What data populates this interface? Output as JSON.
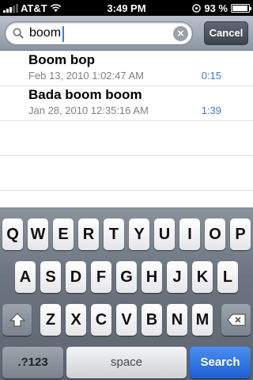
{
  "status_bar": {
    "carrier": "AT&T",
    "time": "3:49 PM",
    "battery_percent": "93 %",
    "battery_level": 0.93,
    "signal_bars_on": 3
  },
  "search": {
    "query": "boom",
    "cancel_label": "Cancel"
  },
  "results": [
    {
      "title": "Boom bop",
      "date": "Feb 13, 2010 1:02:47 AM",
      "duration": "0:15"
    },
    {
      "title": "Bada boom boom",
      "date": "Jan 28, 2010 12:35:16 AM",
      "duration": "1:39"
    }
  ],
  "keyboard": {
    "row1": [
      "Q",
      "W",
      "E",
      "R",
      "T",
      "Y",
      "U",
      "I",
      "O",
      "P"
    ],
    "row2": [
      "A",
      "S",
      "D",
      "F",
      "G",
      "H",
      "J",
      "K",
      "L"
    ],
    "row3": [
      "Z",
      "X",
      "C",
      "V",
      "B",
      "N",
      "M"
    ],
    "numbers_label": ".?123",
    "space_label": "space",
    "search_label": "Search"
  },
  "colors": {
    "accent": "#3b7ad5",
    "search_key": "#1e5fd2"
  }
}
